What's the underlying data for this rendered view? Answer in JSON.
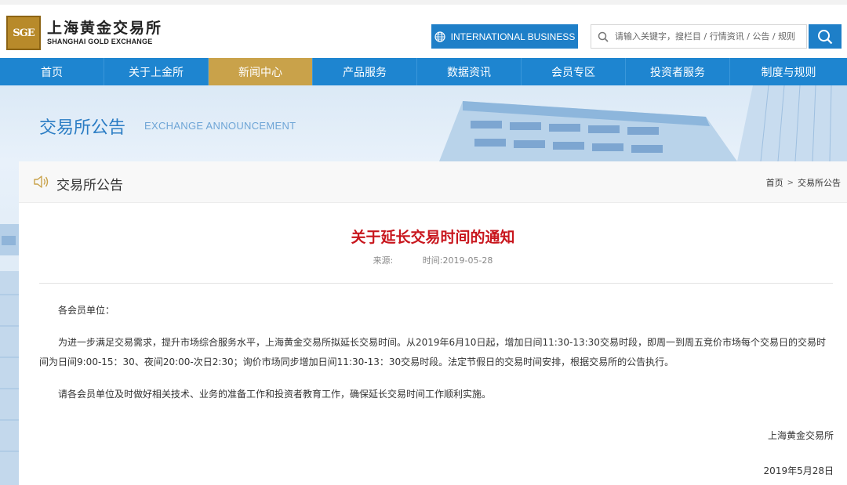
{
  "header": {
    "logo_mark": "SGE",
    "logo_cn": "上海黄金交易所",
    "logo_en": "SHANGHAI GOLD EXCHANGE",
    "intl_button": "INTERNATIONAL BUSINESS",
    "search_placeholder": "请输入关键字，搜栏目 / 行情资讯 / 公告 / 规则"
  },
  "nav": {
    "items": [
      {
        "label": "首页"
      },
      {
        "label": "关于上金所"
      },
      {
        "label": "新闻中心"
      },
      {
        "label": "产品服务"
      },
      {
        "label": "数据资讯"
      },
      {
        "label": "会员专区"
      },
      {
        "label": "投资者服务"
      },
      {
        "label": "制度与规则"
      }
    ],
    "active_index": 2
  },
  "banner": {
    "title": "交易所公告",
    "subtitle": "EXCHANGE ANNOUNCEMENT"
  },
  "panel": {
    "title": "交易所公告",
    "breadcrumb": [
      "首页",
      "交易所公告"
    ],
    "breadcrumb_sep": ">"
  },
  "article": {
    "title": "关于延长交易时间的通知",
    "source_label": "来源:",
    "time_label": "时间:2019-05-28",
    "salutation": "各会员单位：",
    "paragraph1": "为进一步满足交易需求，提升市场综合服务水平，上海黄金交易所拟延长交易时间。从2019年6月10日起，增加日间11:30-13:30交易时段，即周一到周五竞价市场每个交易日的交易时间为日间9:00-15：30、夜间20:00-次日2:30；询价市场同步增加日间11:30-13：30交易时段。法定节假日的交易时间安排，根据交易所的公告执行。",
    "paragraph2": "请各会员单位及时做好相关技术、业务的准备工作和投资者教育工作，确保延长交易时间工作顺利实施。",
    "signature": "上海黄金交易所",
    "date": "2019年5月28日"
  },
  "colors": {
    "brand_blue": "#1e85d0",
    "active_gold": "#c9a24a",
    "title_red": "#c8161d"
  }
}
